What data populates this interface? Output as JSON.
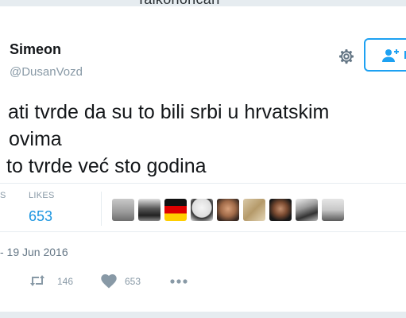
{
  "background_title_fragment": "Talkohoncari",
  "user": {
    "name": "Simeon",
    "handle": "@DusanVozd"
  },
  "follow_button": {
    "label_fragment": "F"
  },
  "tweet": {
    "lines": [
      "ati tvrde da su to bili srbi u hrvatskim",
      "ovima",
      "to tvrde već sto godina"
    ]
  },
  "stats": {
    "retweets_label_fragment": "S",
    "likes_label": "LIKES",
    "likes_value": "653"
  },
  "timestamp_fragment": "- 19 Jun 2016",
  "actions": {
    "retweet_count": "146",
    "like_count": "653"
  },
  "colors": {
    "accent": "#1da1f2",
    "link_value": "#1b95e0",
    "muted": "#8899a6",
    "background": "#e6ecf0"
  },
  "icons": {
    "settings": "gear-icon",
    "follow": "add-user-icon",
    "retweet": "retweet-icon",
    "like": "heart-icon",
    "more": "more-icon"
  }
}
